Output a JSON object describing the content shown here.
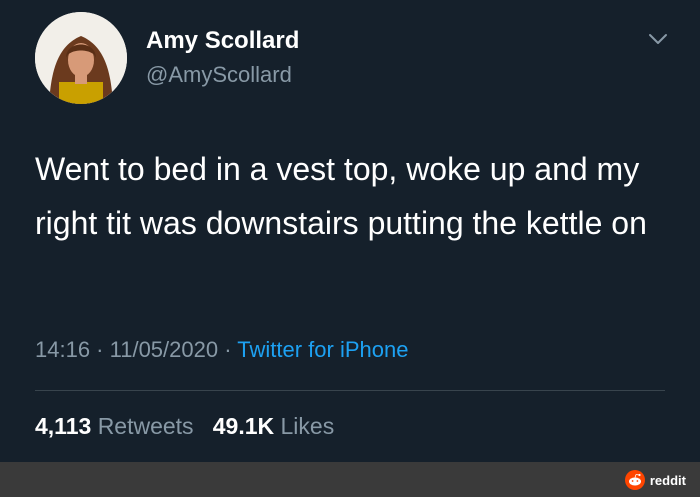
{
  "tweet": {
    "display_name": "Amy Scollard",
    "handle": "@AmyScollard",
    "text": "Went to bed in a vest top, woke up and my right tit was downstairs putting the kettle on",
    "time": "14:16",
    "date": "11/05/2020",
    "separator": " · ",
    "source": "Twitter for iPhone",
    "retweets_count": "4,113",
    "retweets_label": "Retweets",
    "likes_count": "49.1K",
    "likes_label": "Likes"
  },
  "watermark": {
    "text": "reddit"
  },
  "colors": {
    "background": "#15202b",
    "primary_text": "#ffffff",
    "secondary_text": "#8899a6",
    "link": "#1da1f2",
    "divider": "#38444d",
    "reddit_orange": "#ff4500"
  },
  "icons": {
    "menu": "chevron-down-icon",
    "watermark": "reddit-logo-icon"
  }
}
